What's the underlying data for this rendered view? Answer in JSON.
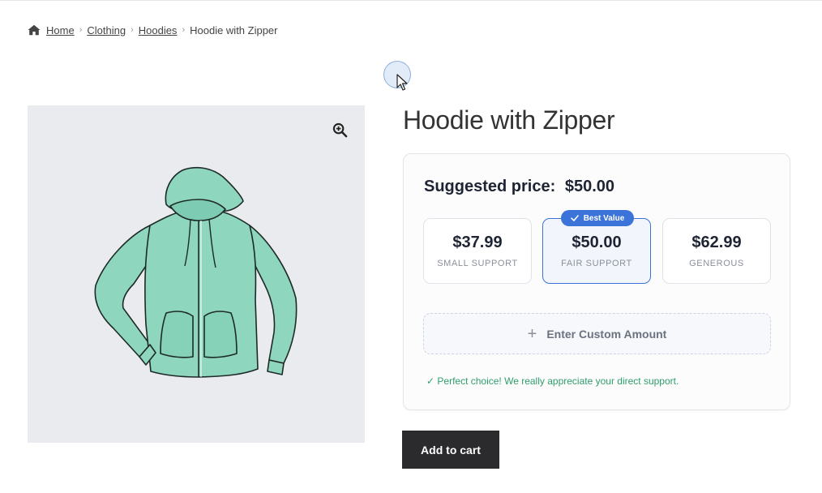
{
  "breadcrumb": {
    "icon": "home-icon",
    "items": [
      "Home",
      "Clothing",
      "Hoodies"
    ],
    "current": "Hoodie with Zipper"
  },
  "product": {
    "title": "Hoodie with Zipper",
    "image_subject": "hoodie-illustration",
    "zoom_icon": "magnifier-zoom-icon"
  },
  "pricing": {
    "suggested_label": "Suggested price:",
    "suggested_value": "$50.00",
    "options": [
      {
        "amount": "$37.99",
        "label": "SMALL SUPPORT"
      },
      {
        "amount": "$50.00",
        "label": "FAIR SUPPORT"
      },
      {
        "amount": "$62.99",
        "label": "GENEROUS"
      }
    ],
    "selected_index": 1,
    "badge": "Best Value",
    "custom_label": "Enter Custom Amount",
    "message": "✓ Perfect choice! We really appreciate your direct support."
  },
  "cart": {
    "button_label": "Add to cart"
  },
  "colors": {
    "accent": "#3b73d9",
    "success": "#2f9e6b",
    "button_bg": "#2b2b2e",
    "hoodie": "#8fd6bf"
  }
}
